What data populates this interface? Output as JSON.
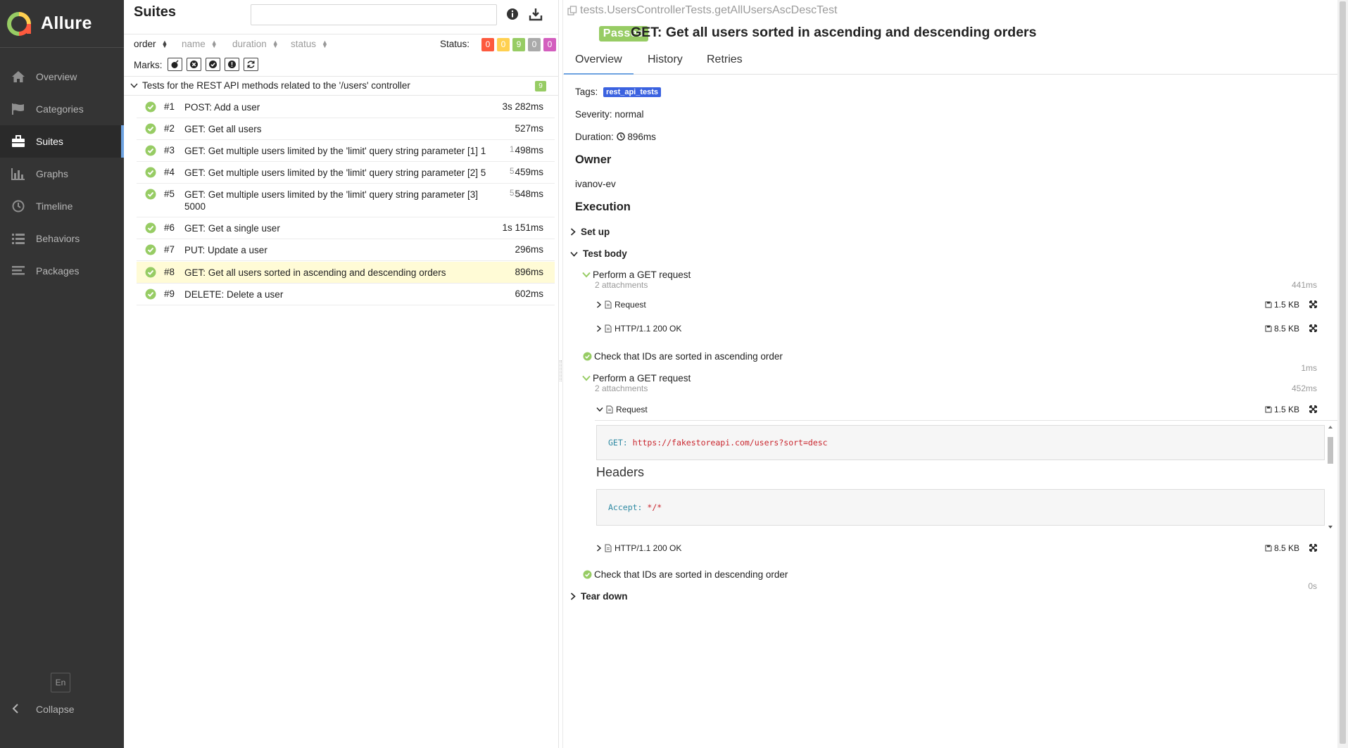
{
  "sidebar": {
    "brand": "Allure",
    "items": [
      {
        "label": "Overview",
        "icon": "home-icon"
      },
      {
        "label": "Categories",
        "icon": "flag-icon"
      },
      {
        "label": "Suites",
        "icon": "briefcase-icon",
        "active": true
      },
      {
        "label": "Graphs",
        "icon": "bar-chart-icon"
      },
      {
        "label": "Timeline",
        "icon": "clock-icon"
      },
      {
        "label": "Behaviors",
        "icon": "list-icon"
      },
      {
        "label": "Packages",
        "icon": "lines-icon"
      }
    ],
    "language": "En",
    "collapse": "Collapse"
  },
  "suites": {
    "title": "Suites",
    "search_value": "",
    "sort": {
      "order": "order",
      "name": "name",
      "duration": "duration",
      "status": "status"
    },
    "status_label": "Status:",
    "status_counts": [
      {
        "value": "0",
        "color": "#fd5a3e"
      },
      {
        "value": "0",
        "color": "#ffd050"
      },
      {
        "value": "9",
        "color": "#97cc64"
      },
      {
        "value": "0",
        "color": "#aaaaaa"
      },
      {
        "value": "0",
        "color": "#d35ebe"
      }
    ],
    "marks_label": "Marks:",
    "group": {
      "title": "Tests for the REST API methods related to the '/users' controller",
      "count": "9"
    },
    "tests": [
      {
        "num": "#1",
        "name": "POST: Add a user",
        "param": "",
        "duration": "3s 282ms"
      },
      {
        "num": "#2",
        "name": "GET: Get all users",
        "param": "",
        "duration": "527ms"
      },
      {
        "num": "#3",
        "name": "GET: Get multiple users limited by the 'limit' query string parameter [1] 1",
        "param": "1",
        "duration": "498ms"
      },
      {
        "num": "#4",
        "name": "GET: Get multiple users limited by the 'limit' query string parameter [2] 5",
        "param": "5",
        "duration": "459ms"
      },
      {
        "num": "#5",
        "name": "GET: Get multiple users limited by the 'limit' query string parameter [3] 5000",
        "param": "5...",
        "duration": "548ms"
      },
      {
        "num": "#6",
        "name": "GET: Get a single user",
        "param": "",
        "duration": "1s 151ms"
      },
      {
        "num": "#7",
        "name": "PUT: Update a user",
        "param": "",
        "duration": "296ms"
      },
      {
        "num": "#8",
        "name": "GET: Get all users sorted in ascending and descending orders",
        "param": "",
        "duration": "896ms",
        "selected": true
      },
      {
        "num": "#9",
        "name": "DELETE: Delete a user",
        "param": "",
        "duration": "602ms"
      }
    ]
  },
  "detail": {
    "fullname": "tests.UsersControllerTests.getAllUsersAscDescTest",
    "status": "Passed",
    "title": "GET: Get all users sorted in ascending and descending orders",
    "tabs": [
      "Overview",
      "History",
      "Retries"
    ],
    "tags_label": "Tags:",
    "tag": "rest_api_tests",
    "severity_label": "Severity:",
    "severity": "normal",
    "duration_label": "Duration:",
    "duration": "896ms",
    "owner_heading": "Owner",
    "owner": "ivanov-ev",
    "execution_heading": "Execution",
    "setup": "Set up",
    "test_body": "Test body",
    "teardown": "Tear down",
    "steps": [
      {
        "name": "Perform a GET request",
        "sub": "2 attachments",
        "time": "441ms"
      },
      {
        "name": "Check that IDs are sorted in ascending order",
        "sub": "",
        "time": "1ms"
      },
      {
        "name": "Perform a GET request",
        "sub": "2 attachments",
        "time": "452ms"
      },
      {
        "name": "Check that IDs are sorted in descending order",
        "sub": "",
        "time": "0s"
      }
    ],
    "attachments": [
      {
        "name": "Request",
        "size": "1.5 KB"
      },
      {
        "name": "HTTP/1.1 200 OK",
        "size": "8.5 KB"
      },
      {
        "name": "Request",
        "size": "1.5 KB"
      },
      {
        "name": "HTTP/1.1 200 OK",
        "size": "8.5 KB"
      }
    ],
    "request": {
      "method_key": "GET:",
      "url": "https://fakestoreapi.com/users?sort=desc",
      "headers_heading": "Headers",
      "header_key": "Accept:",
      "header_value": "*/*"
    }
  }
}
